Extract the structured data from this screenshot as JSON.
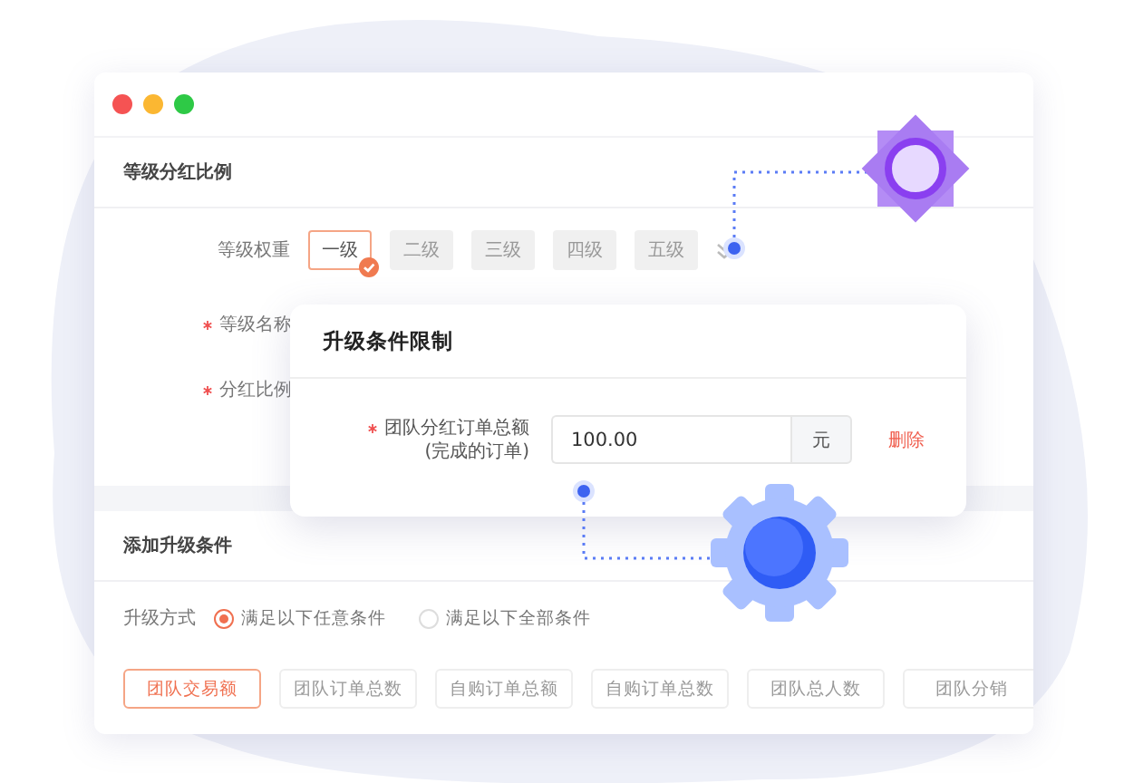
{
  "section_title": "等级分红比例",
  "level_label": "等级权重",
  "levels": [
    {
      "label": "一级",
      "selected": true
    },
    {
      "label": "二级",
      "selected": false
    },
    {
      "label": "三级",
      "selected": false
    },
    {
      "label": "四级",
      "selected": false
    },
    {
      "label": "五级",
      "selected": false
    }
  ],
  "fields": [
    {
      "label": "等级名称",
      "required": true
    },
    {
      "label": "分红比例",
      "required": true
    }
  ],
  "popup": {
    "title": "升级条件限制",
    "field_label": "团队分红订单总额",
    "field_note": "(完成的订单)",
    "required": true,
    "value": "100.00",
    "unit": "元",
    "delete_link": "删除"
  },
  "conditions_title": "添加升级条件",
  "upgrade_label": "升级方式",
  "upgrade_options": [
    {
      "label": "满足以下任意条件",
      "selected": true
    },
    {
      "label": "满足以下全部条件",
      "selected": false
    }
  ],
  "conditions": [
    {
      "label": "团队交易额",
      "selected": true
    },
    {
      "label": "团队订单总数",
      "selected": false
    },
    {
      "label": "自购订单总额",
      "selected": false
    },
    {
      "label": "自购订单总数",
      "selected": false
    },
    {
      "label": "团队总人数",
      "selected": false
    },
    {
      "label": "团队分销",
      "selected": false
    }
  ]
}
